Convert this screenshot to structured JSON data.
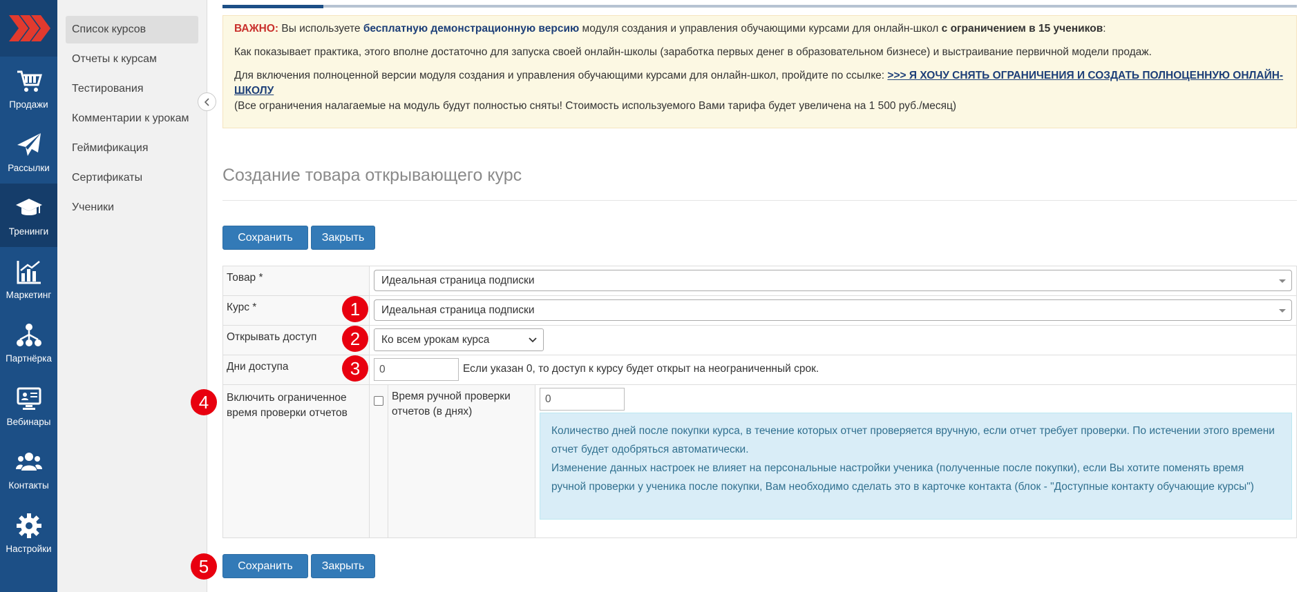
{
  "nav": {
    "items": [
      {
        "label": "Продажи",
        "icon": "cart-icon"
      },
      {
        "label": "Рассылки",
        "icon": "paper-plane-icon"
      },
      {
        "label": "Тренинги",
        "icon": "graduation-cap-icon",
        "active": true
      },
      {
        "label": "Маркетинг",
        "icon": "bar-chart-icon"
      },
      {
        "label": "Партнёрка",
        "icon": "network-icon"
      },
      {
        "label": "Вебинары",
        "icon": "webinar-icon"
      },
      {
        "label": "Контакты",
        "icon": "users-icon"
      },
      {
        "label": "Настройки",
        "icon": "gear-icon"
      }
    ]
  },
  "submenu": {
    "items": [
      {
        "label": "Список курсов",
        "active": true
      },
      {
        "label": "Отчеты к курсам"
      },
      {
        "label": "Тестирования"
      },
      {
        "label": "Комментарии к урокам"
      },
      {
        "label": "Геймификация"
      },
      {
        "label": "Сертификаты"
      },
      {
        "label": "Ученики"
      }
    ]
  },
  "alert": {
    "line1": {
      "important": "ВАЖНО:",
      "t1": " Вы используете ",
      "demo": "бесплатную демонстрационную версию",
      "t2": " модуля создания и управления обучающими курсами для онлайн-школ ",
      "limit": "с ограничением в 15 учеников",
      "t3": ":"
    },
    "line2": "Как показывает практика, этого вполне достаточно для запуска своей онлайн-школы (заработка первых денег в образовательном бизнесе) и выстраивание первичной модели продаж.",
    "line3_text": "Для включения полноценной версии модуля создания и управления обучающими курсами для онлайн-школ, пройдите по ссылке: ",
    "line3_link": ">>> Я ХОЧУ СНЯТЬ ОГРАНИЧЕНИЯ И СОЗДАТЬ ПОЛНОЦЕННУЮ ОНЛАЙН-ШКОЛУ",
    "line4": "(Все ограничения налагаемые на модуль будут полностью сняты! Стоимость используемого Вами тарифа будет увеличена на 1 500 руб./месяц)"
  },
  "page_title": "Создание товара открывающего курс",
  "buttons": {
    "save": "Сохранить",
    "close": "Закрыть"
  },
  "form": {
    "product": {
      "label": "Товар *",
      "value": "Идеальная страница подписки"
    },
    "course": {
      "label": "Курс *",
      "value": "Идеальная страница подписки"
    },
    "access": {
      "label": "Открывать доступ",
      "value": "Ко всем урокам курса"
    },
    "days": {
      "label": "Дни доступа",
      "value": "0",
      "hint": "Если указан 0, то доступ к курсу будет открыт на неограниченный срок."
    },
    "limited": {
      "label": "Включить ограниченное время проверки отчетов",
      "checked": false,
      "sublabel": "Время ручной проверки отчетов (в днях)",
      "value": "0",
      "info1": "Количество дней после покупки курса, в течение которых отчет проверяется вручную, если отчет требует проверки. По истечении этого времени отчет будет одобряться автоматически.",
      "info2": "Изменение данных настроек не влияет на персональные настройки ученика (полученные после покупки), если Вы хотите поменять время ручной проверки у ученика после покупки, Вам необходимо сделать это в карточке контакта (блок - \"Доступные контакту обучающие курсы\")"
    }
  },
  "badges": [
    "1",
    "2",
    "3",
    "4",
    "5"
  ],
  "colors": {
    "rail": "#1c4f86",
    "primary": "#337ab7",
    "badge": "#e8000f",
    "alert_bg": "#fcf8e3",
    "info_bg": "#d9edf7"
  }
}
